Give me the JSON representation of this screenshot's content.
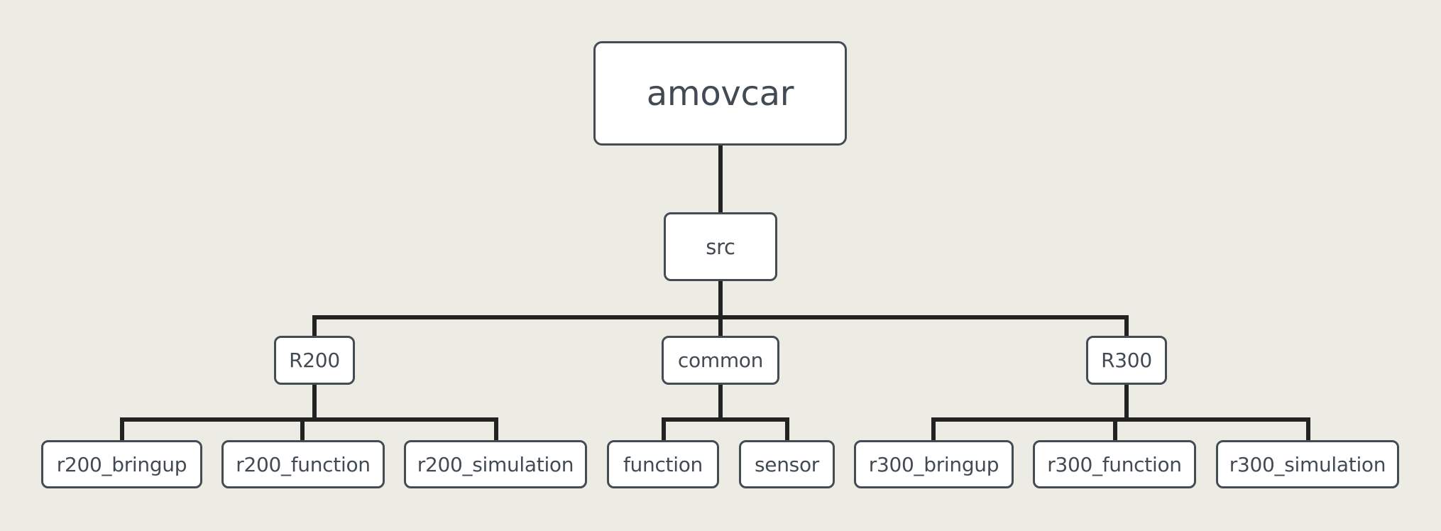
{
  "diagram": {
    "type": "tree",
    "colors": {
      "background": "#ECECE4",
      "node_fill": "#FFFFFF",
      "node_border": "#434B53",
      "text": "#424A53",
      "connector": "#222222"
    },
    "root": {
      "label": "amovcar",
      "children": [
        {
          "label": "src",
          "children": [
            {
              "label": "R200",
              "children": [
                {
                  "label": "r200_bringup"
                },
                {
                  "label": "r200_function"
                },
                {
                  "label": "r200_simulation"
                }
              ]
            },
            {
              "label": "common",
              "children": [
                {
                  "label": "function"
                },
                {
                  "label": "sensor"
                }
              ]
            },
            {
              "label": "R300",
              "children": [
                {
                  "label": "r300_bringup"
                },
                {
                  "label": "r300_function"
                },
                {
                  "label": "r300_simulation"
                }
              ]
            }
          ]
        }
      ]
    }
  }
}
